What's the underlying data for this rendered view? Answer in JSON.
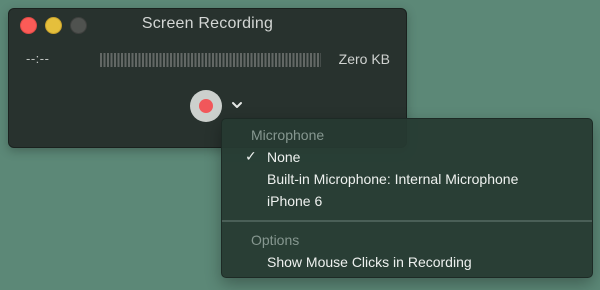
{
  "window": {
    "title": "Screen Recording",
    "elapsed_time": "--:--",
    "file_size": "Zero KB",
    "level_meter_level": 0
  },
  "controls": {
    "record_icon": "record-dot-icon",
    "options_icon": "chevron-down-icon"
  },
  "menu": {
    "microphone_header": "Microphone",
    "microphone_items": [
      {
        "label": "None",
        "checked": true
      },
      {
        "label": "Built-in Microphone: Internal Microphone",
        "checked": false
      },
      {
        "label": "iPhone 6",
        "checked": false
      }
    ],
    "options_header": "Options",
    "options_items": [
      {
        "label": "Show Mouse Clicks in Recording",
        "checked": false
      }
    ],
    "check_glyph": "✓"
  },
  "colors": {
    "desktop": "#5c8877",
    "window_bg": "#28322e",
    "menu_bg": "#263a32",
    "record_red": "#f1575a",
    "close": "#fc5b57",
    "minimize": "#e5bf3c"
  }
}
